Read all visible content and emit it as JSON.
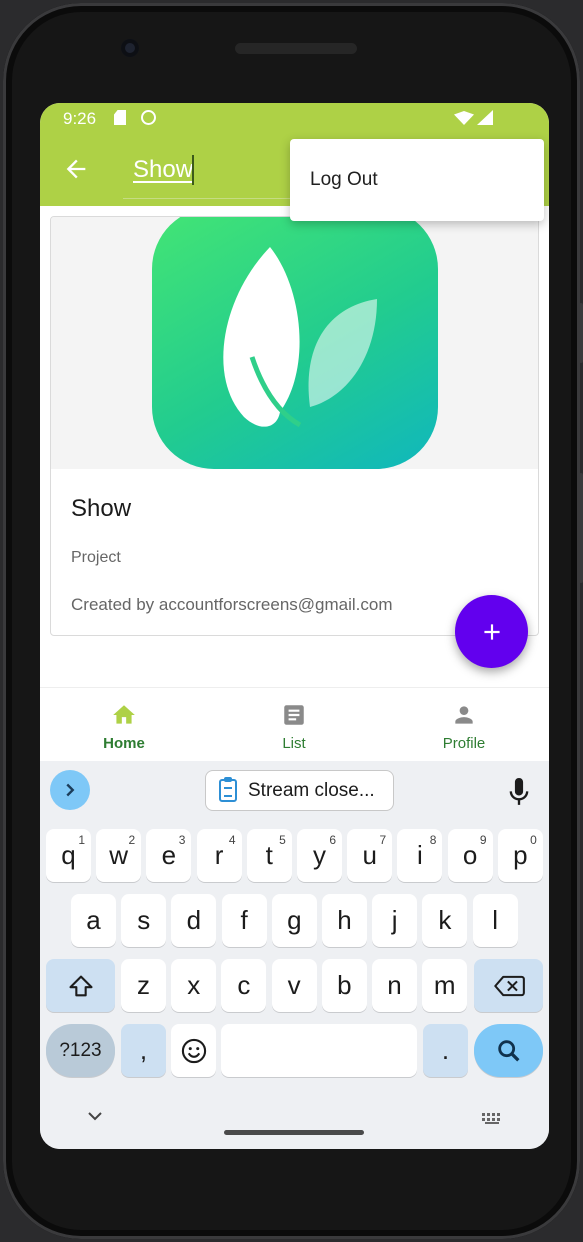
{
  "status_bar": {
    "time": "9:26"
  },
  "app_bar": {
    "title_input_value": "Show",
    "back_icon": "arrow-left-icon"
  },
  "overflow_menu": {
    "items": [
      {
        "label": "Log Out"
      }
    ]
  },
  "project_card": {
    "image_icon": "leaf-logo-icon",
    "title": "Show",
    "subtitle": "Project",
    "created_by": "Created by accountforscreens@gmail.com"
  },
  "fab": {
    "icon": "plus-icon",
    "color": "#6200ee"
  },
  "bottom_nav": {
    "items": [
      {
        "label": "Home",
        "icon": "home-icon",
        "active": true
      },
      {
        "label": "List",
        "icon": "list-icon",
        "active": false
      },
      {
        "label": "Profile",
        "icon": "person-icon",
        "active": false
      }
    ]
  },
  "keyboard": {
    "suggestion": "Stream close...",
    "row1": [
      "q",
      "w",
      "e",
      "r",
      "t",
      "y",
      "u",
      "i",
      "o",
      "p"
    ],
    "row1_hints": [
      "1",
      "2",
      "3",
      "4",
      "5",
      "6",
      "7",
      "8",
      "9",
      "0"
    ],
    "row2": [
      "a",
      "s",
      "d",
      "f",
      "g",
      "h",
      "j",
      "k",
      "l"
    ],
    "row3": [
      "z",
      "x",
      "c",
      "v",
      "b",
      "n",
      "m"
    ],
    "row4": {
      "symbols": "?123",
      "comma": ",",
      "period": "."
    }
  },
  "colors": {
    "app_bar": "#aed146",
    "nav_text": "#2e7d32",
    "accent_blue": "#7ec8f7"
  }
}
